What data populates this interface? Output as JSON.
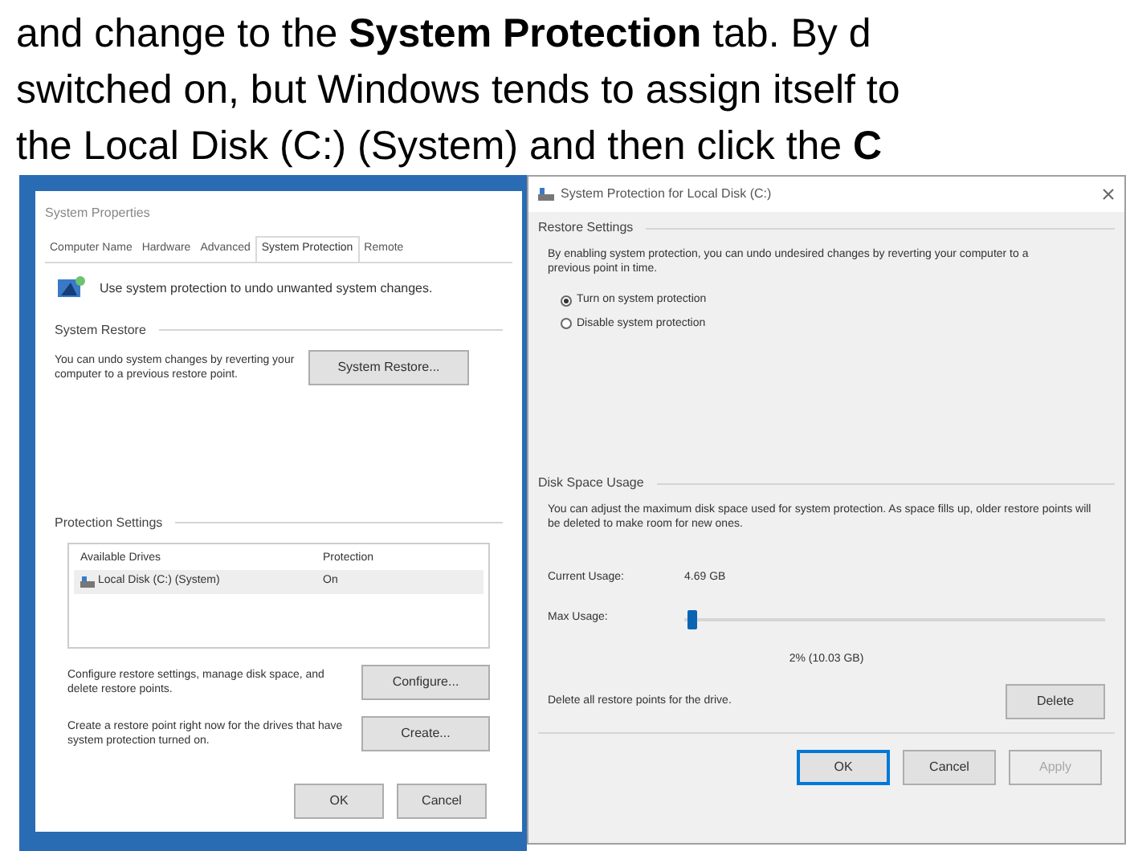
{
  "article": {
    "lines": [
      "and change to the **System Protection** tab. By d",
      "switched on, but Windows tends to assign itself to",
      "the Local Disk (C:) (System) and then click the **C**"
    ]
  },
  "system_properties": {
    "title": "System Properties",
    "tabs": [
      {
        "label": "Computer Name",
        "selected": false
      },
      {
        "label": "Hardware",
        "selected": false
      },
      {
        "label": "Advanced",
        "selected": false
      },
      {
        "label": "System Protection",
        "selected": true
      },
      {
        "label": "Remote",
        "selected": false
      }
    ],
    "intro": "Use system protection to undo unwanted system changes.",
    "system_restore": {
      "heading": "System Restore",
      "text": "You can undo system changes by reverting your computer to a previous restore point.",
      "button": "System Restore..."
    },
    "protection_settings": {
      "heading": "Protection Settings",
      "columns": [
        "Available Drives",
        "Protection"
      ],
      "rows": [
        {
          "drive": "Local Disk (C:) (System)",
          "protection": "On",
          "selected": true
        }
      ],
      "configure": {
        "text": "Configure restore settings, manage disk space, and delete restore points.",
        "button": "Configure..."
      },
      "create": {
        "text": "Create a restore point right now for the drives that have system protection turned on.",
        "button": "Create..."
      }
    },
    "buttons": [
      {
        "label": "OK"
      },
      {
        "label": "Cancel"
      }
    ]
  },
  "protection_dialog": {
    "title": "System Protection for Local Disk (C:)",
    "restore_settings": {
      "heading": "Restore Settings",
      "text": "By enabling system protection, you can undo undesired changes by reverting your computer to a previous point in time.",
      "options": [
        {
          "label": "Turn on system protection",
          "selected": true
        },
        {
          "label": "Disable system protection",
          "selected": false
        }
      ]
    },
    "disk_space": {
      "heading": "Disk Space Usage",
      "text": "You can adjust the maximum disk space used for system protection. As space fills up, older restore points will be deleted to make room for new ones.",
      "current_label": "Current Usage:",
      "current_value": "4.69 GB",
      "max_label": "Max Usage:",
      "level": 0.02,
      "reading": "2% (10.03 GB)",
      "delete_text": "Delete all restore points for the drive.",
      "delete_button": "Delete"
    },
    "buttons": [
      {
        "label": "OK",
        "kind": "default",
        "disabled": false
      },
      {
        "label": "Cancel",
        "kind": "normal",
        "disabled": false
      },
      {
        "label": "Apply",
        "kind": "normal",
        "disabled": true
      }
    ]
  }
}
